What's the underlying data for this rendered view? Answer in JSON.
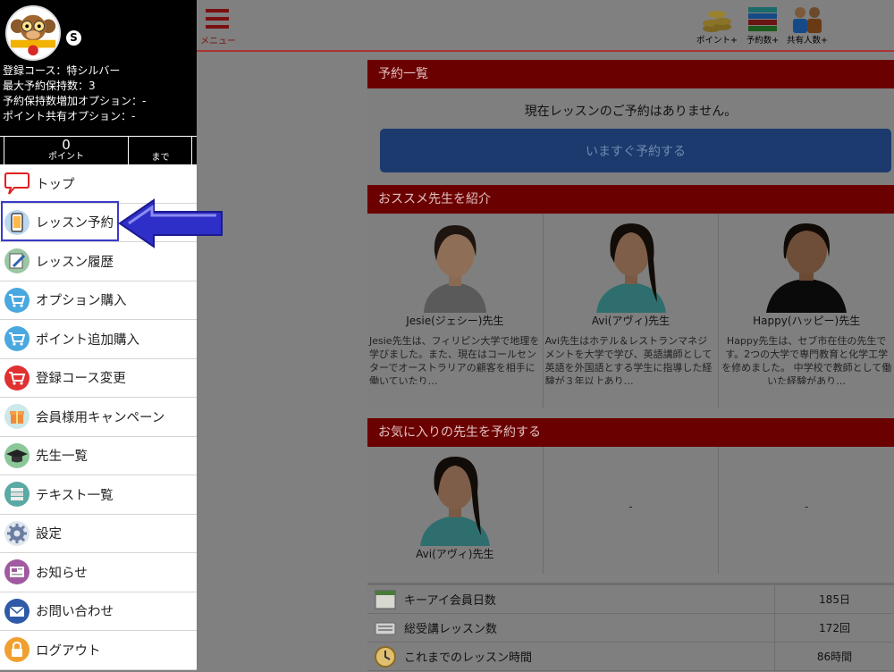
{
  "profile": {
    "badge": "S",
    "course_line": "登録コース：特シルバー",
    "max_reservations_line": "最大予約保持数：3",
    "reservation_option_line": "予約保持数増加オプション：-",
    "point_share_option_line": "ポイント共有オプション：-",
    "points_value": "0",
    "points_label": "ポイント",
    "until_label": "まで"
  },
  "sidebar": {
    "items": [
      {
        "label": "トップ",
        "icon": "speech-bubble-icon"
      },
      {
        "label": "レッスン予約",
        "icon": "smartphone-icon"
      },
      {
        "label": "レッスン履歴",
        "icon": "notebook-pencil-icon"
      },
      {
        "label": "オプション購入",
        "icon": "cart-icon"
      },
      {
        "label": "ポイント追加購入",
        "icon": "cart-icon"
      },
      {
        "label": "登録コース変更",
        "icon": "cart-icon"
      },
      {
        "label": "会員様用キャンペーン",
        "icon": "gift-icon"
      },
      {
        "label": "先生一覧",
        "icon": "graduation-cap-icon"
      },
      {
        "label": "テキスト一覧",
        "icon": "books-icon"
      },
      {
        "label": "設定",
        "icon": "gear-icon"
      },
      {
        "label": "お知らせ",
        "icon": "newspaper-icon"
      },
      {
        "label": "お問い合わせ",
        "icon": "envelope-icon"
      },
      {
        "label": "ログアウト",
        "icon": "lock-icon"
      }
    ]
  },
  "topbar": {
    "menu_label": "メニュー",
    "points_label": "ポイント+",
    "reservations_label": "予約数+",
    "shared_label": "共有人数+"
  },
  "booking": {
    "header": "予約一覧",
    "message": "現在レッスンのご予約はありません。",
    "button": "いますぐ予約する"
  },
  "recommend": {
    "header": "おススメ先生を紹介",
    "teachers": [
      {
        "name": "Jesie(ジェシー)先生",
        "desc": "Jesie先生は、フィリピン大学で地理を学びました。また、現在はコールセンターでオーストラリアの顧客を相手に働いていたり…"
      },
      {
        "name": "Avi(アヴィ)先生",
        "desc": "Avi先生はホテル＆レストランマネジメントを大学で学び、英語講師として英語を外国語とする学生に指導した経験が３年以上あり…"
      },
      {
        "name": "Happy(ハッピー)先生",
        "desc": "Happy先生は、セブ市在住の先生です。2つの大学で専門教育と化学工学を修めました。 中学校で教師として働いた経験があり…"
      }
    ]
  },
  "favorites": {
    "header": "お気に入りの先生を予約する",
    "teacher_name": "Avi(アヴィ)先生",
    "empty_1": "-",
    "empty_2": "-"
  },
  "stats": [
    {
      "label": "キーアイ会員日数",
      "value": "185日",
      "icon": "calendar-icon"
    },
    {
      "label": "総受講レッスン数",
      "value": "172回",
      "icon": "keyboard-icon"
    },
    {
      "label": "これまでのレッスン時間",
      "value": "86時間",
      "icon": "clock-icon"
    }
  ]
}
